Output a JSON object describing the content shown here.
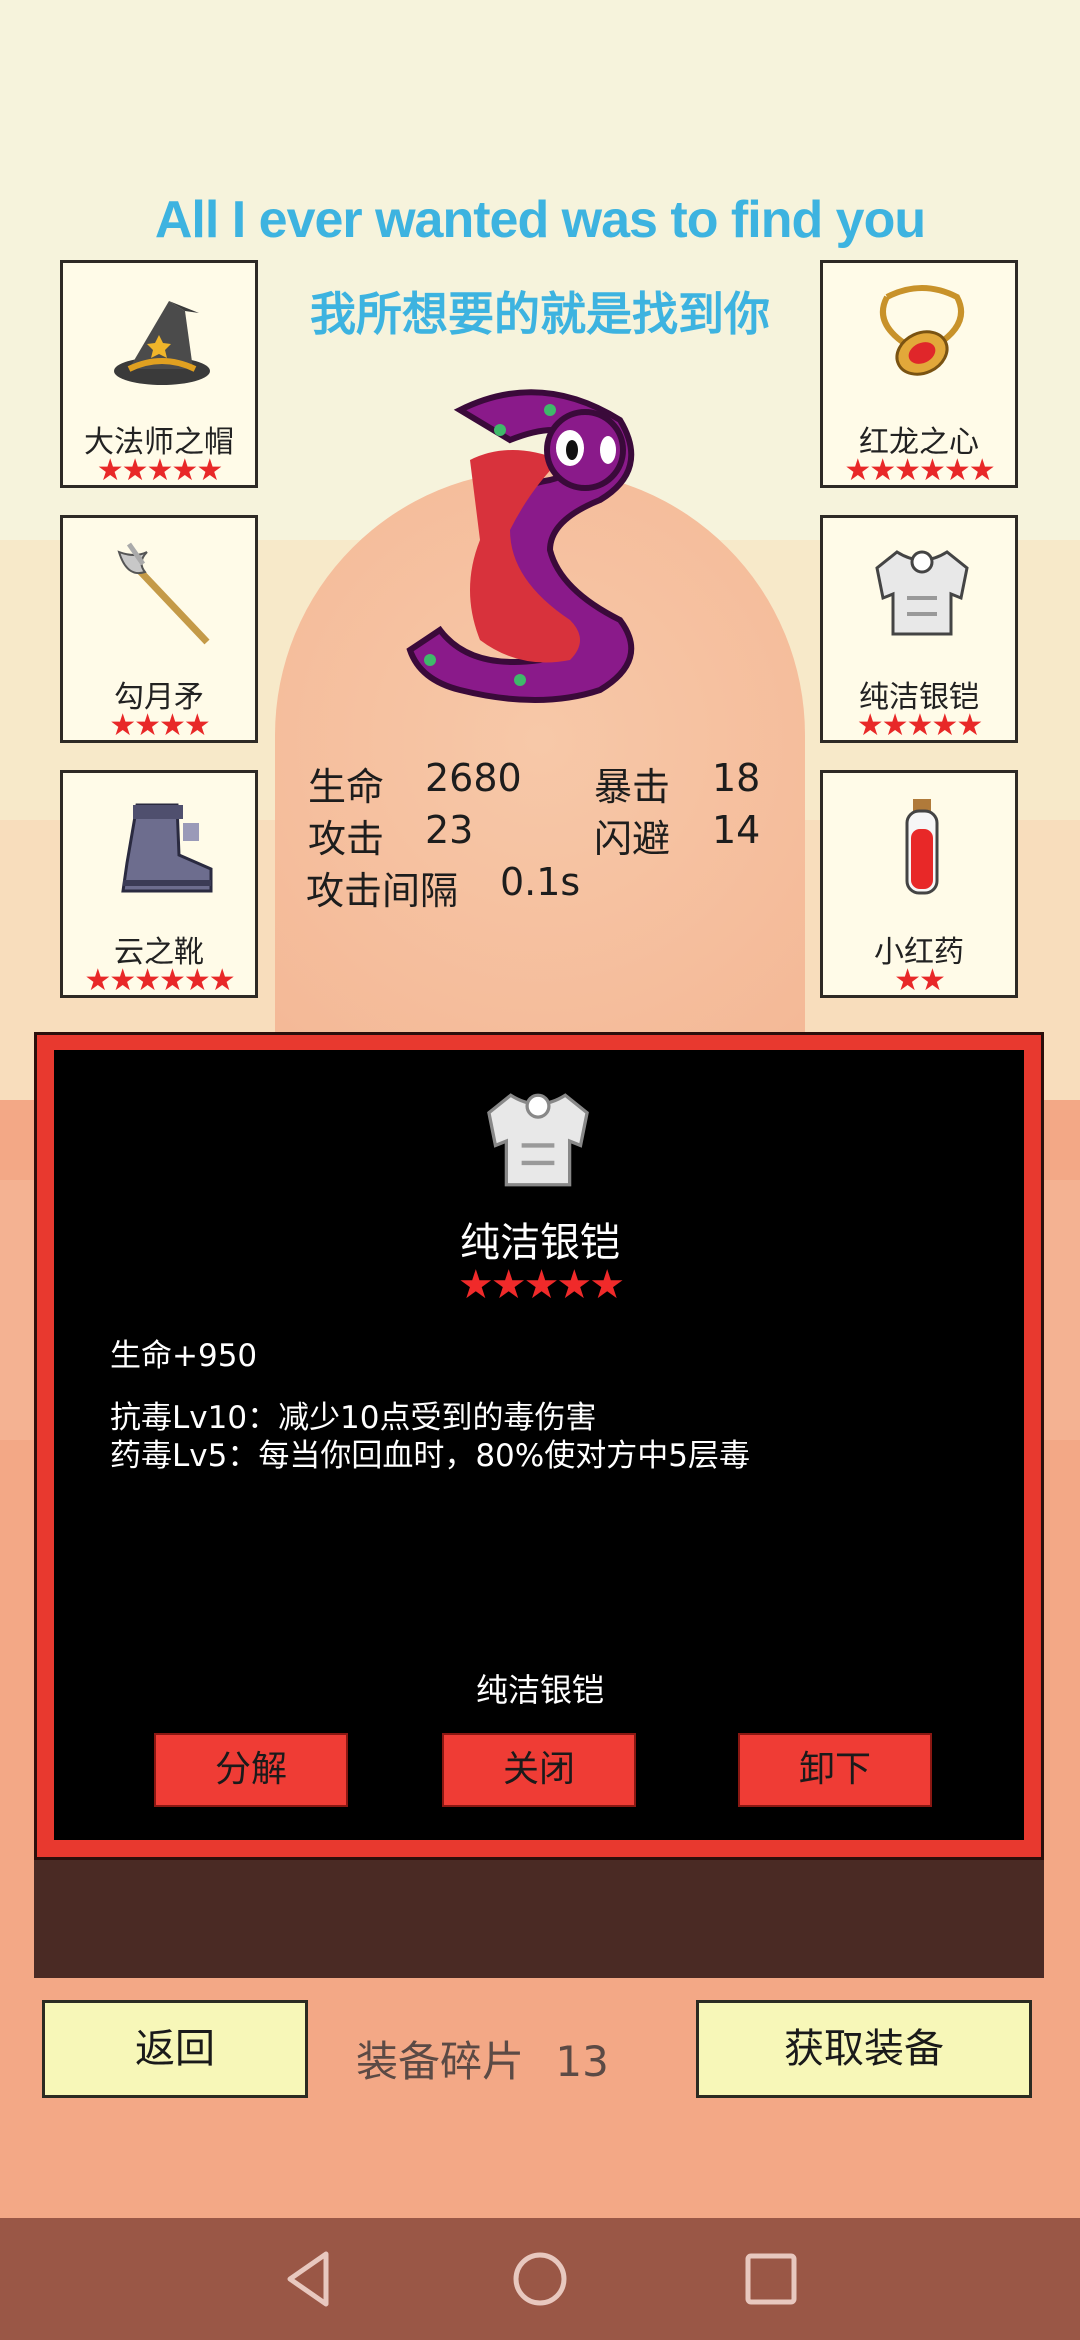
{
  "lyrics": {
    "english": "All I ever wanted was to find you",
    "chinese": "我所想要的就是找到你"
  },
  "equipment_slots": [
    {
      "name": "大法师之帽",
      "stars": "★★★★★",
      "icon": "wizard-hat-icon"
    },
    {
      "name": "红龙之心",
      "stars": "★★★★★★",
      "icon": "amulet-icon"
    },
    {
      "name": "勾月矛",
      "stars": "★★★★",
      "icon": "spear-icon"
    },
    {
      "name": "纯洁银铠",
      "stars": "★★★★★",
      "icon": "armor-icon"
    },
    {
      "name": "云之靴",
      "stars": "★★★★★★",
      "icon": "boots-icon"
    },
    {
      "name": "小红药",
      "stars": "★★",
      "icon": "potion-icon"
    }
  ],
  "stats": {
    "hp_label": "生命",
    "hp_value": "2680",
    "crit_label": "暴击",
    "crit_value": "18",
    "atk_label": "攻击",
    "atk_value": "23",
    "dodge_label": "闪避",
    "dodge_value": "14",
    "interval_label": "攻击间隔",
    "interval_value": "0.1s"
  },
  "detail": {
    "title": "纯洁银铠",
    "stars": "★★★★★",
    "bonus": "生命+950",
    "effect1": "抗毒Lv10：减少10点受到的毒伤害",
    "effect2": "药毒Lv5：每当你回血时，80%使对方中5层毒",
    "footer_name": "纯洁银铠",
    "buttons": {
      "decompose": "分解",
      "close": "关闭",
      "unequip": "卸下"
    }
  },
  "bottom": {
    "back": "返回",
    "fragments_label": "装备碎片",
    "fragments_count": "13",
    "get_equipment": "获取装备"
  },
  "colors": {
    "lyrics": "#3db3e0",
    "star": "#e82828",
    "panel_border": "#e8392f",
    "button_yellow": "#f7f7b8"
  }
}
